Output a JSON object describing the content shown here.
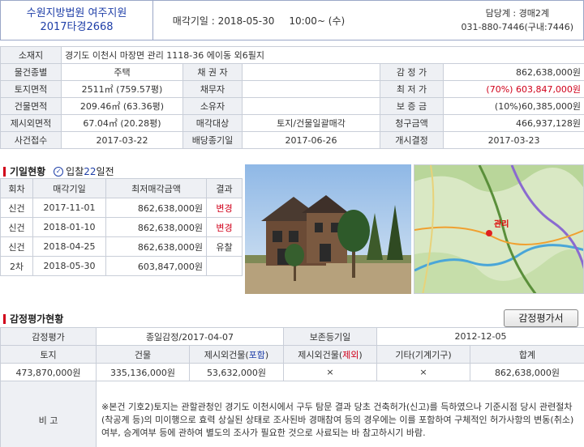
{
  "header": {
    "court_line1": "수원지방법원 여주지원",
    "court_line2": "2017타경2668",
    "sale_date": "매각기일 : 2018-05-30",
    "sale_time": "10:00~ (수)",
    "dept": "담당계 : 경매2계",
    "phone": "031-880-7446(구내:7446)"
  },
  "info": {
    "address_label": "소재지",
    "address": "경기도 이천시 마장면 관리 1118-36 에이동 외6필지",
    "r1": [
      "물건종별",
      "주택",
      "채 권 자",
      "",
      "감 정 가",
      "862,638,000원"
    ],
    "r2": [
      "토지면적",
      "2511㎡ (759.57평)",
      "채무자",
      "",
      "최 저 가",
      "(70%) 603,847,000원"
    ],
    "r3": [
      "건물면적",
      "209.46㎡ (63.36평)",
      "소유자",
      "",
      "보 증 금",
      "(10%)60,385,000원"
    ],
    "r4": [
      "제시외면적",
      "67.04㎡ (20.28평)",
      "매각대상",
      "토지/건물일괄매각",
      "청구금액",
      "466,937,128원"
    ],
    "r5": [
      "사건접수",
      "2017-03-22",
      "배당종기일",
      "2017-06-26",
      "개시결정",
      "2017-03-23"
    ]
  },
  "history": {
    "title": "기일현황",
    "badge_prefix": "입찰",
    "badge_days": "22",
    "badge_suffix": "일전",
    "columns": [
      "회차",
      "매각기일",
      "최저매각금액",
      "결과"
    ],
    "rows": [
      [
        "신건",
        "2017-11-01",
        "862,638,000원",
        "변경"
      ],
      [
        "신건",
        "2018-01-10",
        "862,638,000원",
        "변경"
      ],
      [
        "신건",
        "2018-04-25",
        "862,638,000원",
        "유찰"
      ],
      [
        "2차",
        "2018-05-30",
        "603,847,000원",
        ""
      ]
    ]
  },
  "map": {
    "label": "관리"
  },
  "appraisal": {
    "title": "감정평가현황",
    "button": "감정평가서",
    "row1": [
      "감정평가",
      "종일감정/2017-04-07",
      "보존등기일",
      "2012-12-05"
    ],
    "columns": [
      "토지",
      "건물",
      "제시외건물(",
      "포함",
      ")",
      "제시외건물(",
      "제외",
      ")",
      "기타(기계기구)",
      "합계"
    ],
    "values": [
      "473,870,000원",
      "335,136,000원",
      "53,632,000원",
      "×",
      "×",
      "862,638,000원"
    ],
    "note_label": "비 고",
    "note": "※본건 기호2)토지는 관할관청인 경기도 이천시에서 구두 탐문 결과 당초 건축허가(신고)를 득하였으나 기준시점 당시 관련절차(착공계 등)의 미이행으로 효력 상실된 상태로 조사된바 경매참여 등의 경우에는 이를 포함하여 구체적인 허가사항의 변동(취소)여부, 승계여부 등에 관하여 별도의 조사가 필요한 것으로 사료되는 바 참고하시기 바람."
  },
  "colors": {
    "red": "#d0001a",
    "blue": "#1f3fa8",
    "label_bg": "#eef0f4"
  }
}
